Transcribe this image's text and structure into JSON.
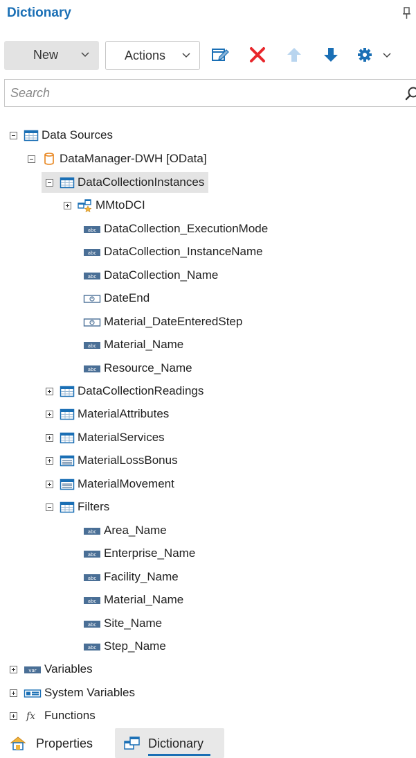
{
  "header": {
    "title": "Dictionary"
  },
  "toolbar": {
    "new_label": "New",
    "actions_label": "Actions"
  },
  "search": {
    "placeholder": "Search"
  },
  "tree": {
    "data_sources": "Data Sources",
    "datamanager": "DataManager-DWH [OData]",
    "dci": "DataCollectionInstances",
    "mmtodci": "MMtoDCI",
    "dci_columns": [
      "DataCollection_ExecutionMode",
      "DataCollection_InstanceName",
      "DataCollection_Name",
      "DateEnd",
      "Material_DateEnteredStep",
      "Material_Name",
      "Resource_Name"
    ],
    "tables": [
      "DataCollectionReadings",
      "MaterialAttributes",
      "MaterialServices",
      "MaterialLossBonus",
      "MaterialMovement"
    ],
    "filters": "Filters",
    "filter_columns": [
      "Area_Name",
      "Enterprise_Name",
      "Facility_Name",
      "Material_Name",
      "Site_Name",
      "Step_Name"
    ],
    "variables": "Variables",
    "system_variables": "System Variables",
    "functions": "Functions"
  },
  "tabs": {
    "properties": "Properties",
    "dictionary": "Dictionary"
  },
  "colors": {
    "accent": "#1a6fb5",
    "delete": "#e8262b",
    "up_disabled": "#b9d5ef",
    "datasource": "#e8841c"
  }
}
